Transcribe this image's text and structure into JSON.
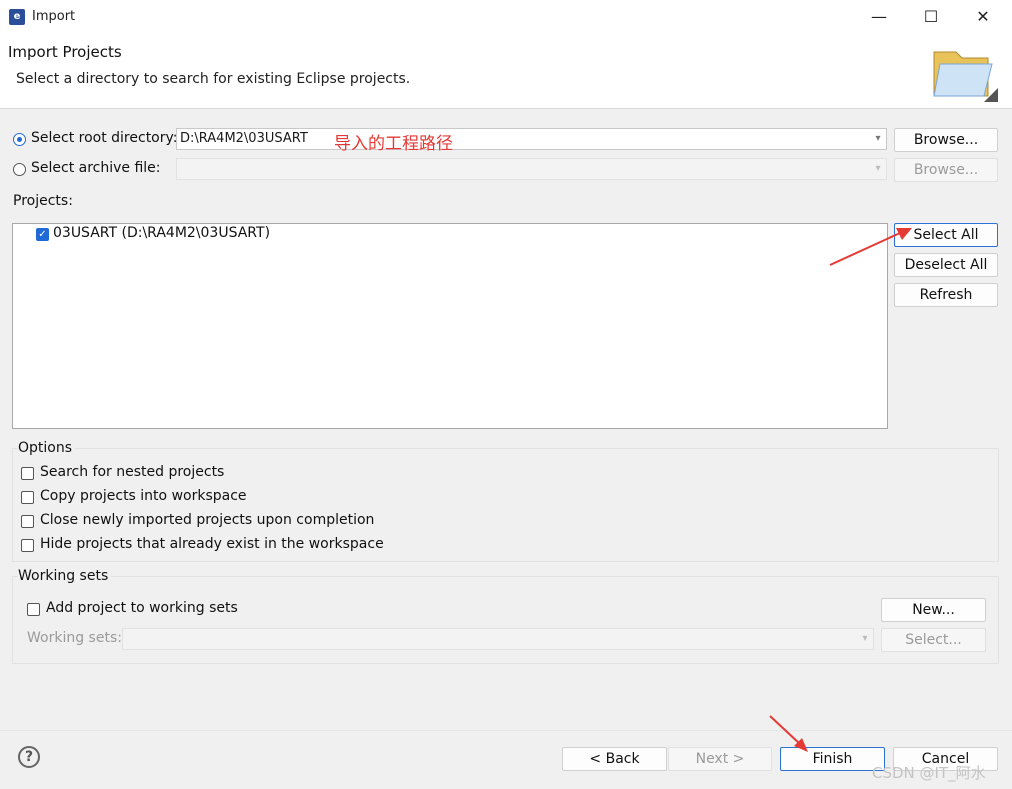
{
  "window": {
    "title": "Import",
    "app_icon_letter": "e",
    "minimize": "—",
    "maximize": "☐",
    "close": "✕"
  },
  "header": {
    "title": "Import Projects",
    "description": "Select a directory to search for existing Eclipse projects."
  },
  "source": {
    "root_label": "Select root directory:",
    "root_value": "D:\\RA4M2\\03USART",
    "archive_label": "Select archive file:",
    "archive_value": "",
    "browse1": "Browse...",
    "browse2": "Browse...",
    "annotation": "导入的工程路径"
  },
  "projects": {
    "label": "Projects:",
    "items": [
      {
        "label": "03USART (D:\\RA4M2\\03USART)",
        "checked": true
      }
    ],
    "select_all": "Select All",
    "deselect_all": "Deselect All",
    "refresh": "Refresh"
  },
  "options": {
    "title": "Options",
    "items": [
      "Search for nested projects",
      "Copy projects into workspace",
      "Close newly imported projects upon completion",
      "Hide projects that already exist in the workspace"
    ]
  },
  "working_sets": {
    "title": "Working sets",
    "add_label": "Add project to working sets",
    "new_button": "New...",
    "sets_label": "Working sets:",
    "select_button": "Select..."
  },
  "footer": {
    "help": "?",
    "back": "< Back",
    "next": "Next >",
    "finish": "Finish",
    "cancel": "Cancel"
  },
  "watermark": "CSDN @IT_阿水",
  "colors": {
    "accent": "#1f6ad6",
    "annotation": "#e53935"
  }
}
